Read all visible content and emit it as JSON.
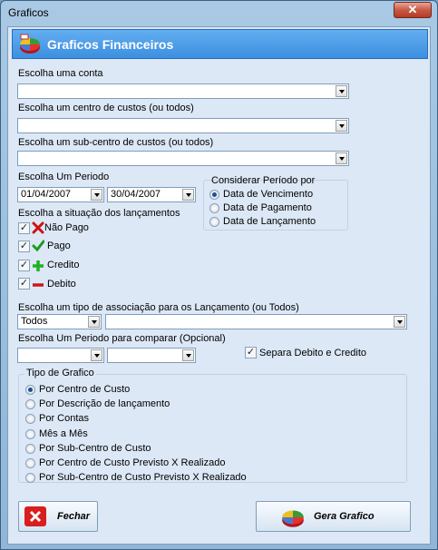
{
  "window": {
    "title": "Graficos",
    "close_symbol": "✕"
  },
  "header": {
    "title": "Graficos Financeiros",
    "icon": "pie-chart-icon"
  },
  "conta": {
    "label": "Escolha uma conta",
    "value": ""
  },
  "centro_custos": {
    "label": "Escolha um centro de custos (ou todos)",
    "value": ""
  },
  "sub_centro": {
    "label": "Escolha um sub-centro de custos (ou todos)",
    "value": ""
  },
  "periodo": {
    "label": "Escolha Um Periodo",
    "start": "01/04/2007",
    "end": "30/04/2007"
  },
  "considerar": {
    "title": "Considerar Período por",
    "options": [
      "Data de Vencimento",
      "Data de Pagamento",
      "Data de Lançamento"
    ],
    "selected": 0
  },
  "situacao": {
    "label": "Escolha a situação dos lançamentos",
    "items": [
      {
        "label": "Não Pago",
        "checked": true,
        "icon": "red-x-icon"
      },
      {
        "label": "Pago",
        "checked": true,
        "icon": "green-check-icon"
      },
      {
        "label": "Credito",
        "checked": true,
        "icon": "green-plus-icon"
      },
      {
        "label": "Debito",
        "checked": true,
        "icon": "red-minus-icon"
      }
    ]
  },
  "associacao": {
    "label": "Escolha um tipo de  associação para os Lançamento (ou Todos)",
    "tipo": "Todos",
    "valor": ""
  },
  "comparar": {
    "label": "Escolha Um Periodo para comparar (Opcional)",
    "start": "",
    "end": ""
  },
  "separa": {
    "label": "Separa Debito e Credito",
    "checked": true
  },
  "tipo_grafico": {
    "title": "Tipo de Grafico",
    "options": [
      "Por Centro de Custo",
      "Por Descrição de lançamento",
      "Por Contas",
      "Mês a Mês",
      "Por Sub-Centro de Custo",
      "Por Centro de Custo Previsto X Realizado",
      "Por Sub-Centro de Custo  Previsto X Realizado"
    ],
    "selected": 0
  },
  "buttons": {
    "fechar": "Fechar",
    "gera": "Gera Grafico"
  }
}
